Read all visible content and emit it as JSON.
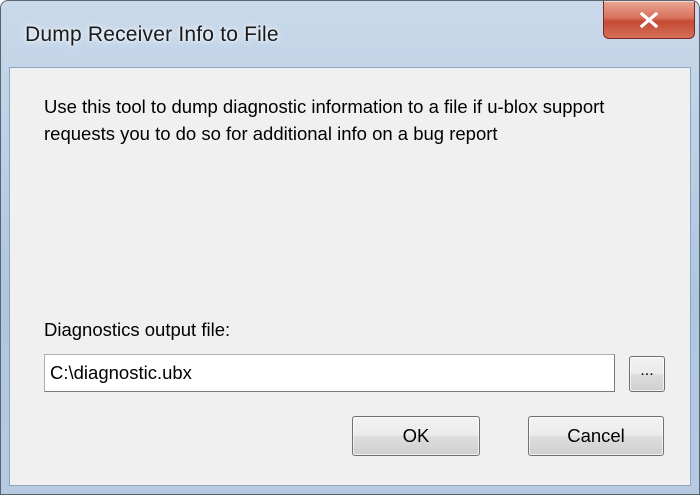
{
  "window": {
    "title": "Dump Receiver Info to File",
    "close_icon": "close-icon"
  },
  "content": {
    "description": "Use this tool to dump diagnostic information to a file if u-blox support requests you to do so for additional info on a bug report",
    "output_label": "Diagnostics output file:",
    "output_path": "C:\\diagnostic.ubx",
    "browse_label": "...",
    "ok_label": "OK",
    "cancel_label": "Cancel"
  },
  "colors": {
    "close_button": "#c44a34",
    "dialog_background": "#f0f0f0",
    "frame": "#bcd0e6"
  }
}
